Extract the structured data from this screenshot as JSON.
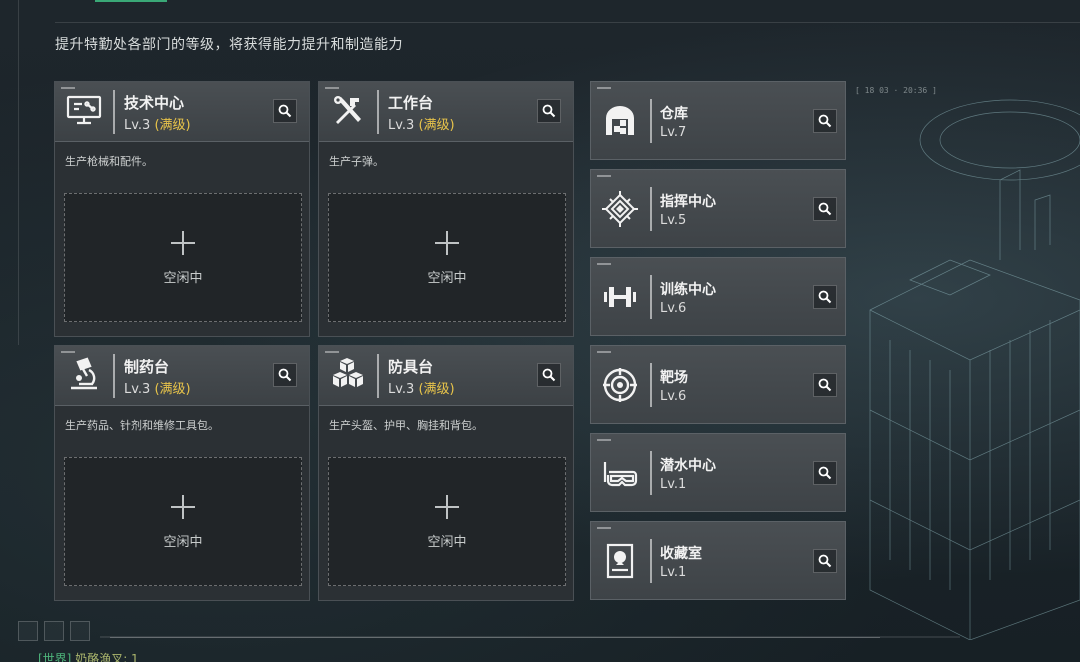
{
  "header": {
    "subtitle": "提升特勤处各部门的等级，将获得能力提升和制造能力",
    "timestamp": "[ 18 03 · 20:36 ]"
  },
  "cards": [
    {
      "name": "技术中心",
      "level": "Lv.3",
      "max": "(满级)",
      "desc": "生产枪械和配件。",
      "icon": "monitor-icon",
      "slot": "空闲中"
    },
    {
      "name": "工作台",
      "level": "Lv.3",
      "max": "(满级)",
      "desc": "生产子弹。",
      "icon": "tools-icon",
      "slot": "空闲中"
    },
    {
      "name": "制药台",
      "level": "Lv.3",
      "max": "(满级)",
      "desc": "生产药品、针剂和维修工具包。",
      "icon": "microscope-icon",
      "slot": "空闲中"
    },
    {
      "name": "防具台",
      "level": "Lv.3",
      "max": "(满级)",
      "desc": "生产头盔、护甲、胸挂和背包。",
      "icon": "cubes-icon",
      "slot": "空闲中"
    }
  ],
  "facilities": [
    {
      "name": "仓库",
      "level": "Lv.7",
      "icon": "warehouse-icon"
    },
    {
      "name": "指挥中心",
      "level": "Lv.5",
      "icon": "chip-icon"
    },
    {
      "name": "训练中心",
      "level": "Lv.6",
      "icon": "dumbbell-icon"
    },
    {
      "name": "靶场",
      "level": "Lv.6",
      "icon": "target-icon"
    },
    {
      "name": "潜水中心",
      "level": "Lv.1",
      "icon": "diving-mask-icon"
    },
    {
      "name": "收藏室",
      "level": "Lv.1",
      "icon": "display-case-icon"
    }
  ],
  "chat": {
    "channel": "[世界]",
    "text": "奶酪渔叉: 1"
  },
  "colors": {
    "accent": "#3aa877",
    "maxed": "#e8c44a",
    "card_bg": "#2b3034"
  }
}
